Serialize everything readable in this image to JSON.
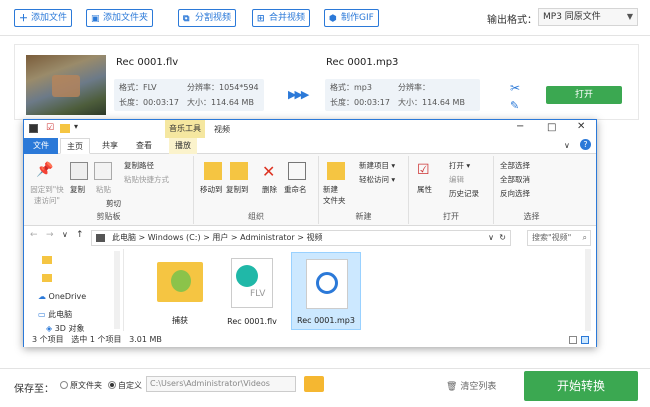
{
  "toolbar": {
    "add_file": "添加文件",
    "add_folder": "添加文件夹",
    "split_video": "分割视频",
    "merge_video": "合并视频",
    "make_gif": "制作GIF",
    "output_format_label": "输出格式：",
    "output_format_value": "MP3  同原文件"
  },
  "task": {
    "source_name": "Rec 0001.flv",
    "source_format_label": "格式：",
    "source_format": "FLV",
    "source_resolution_label": "分辨率：",
    "source_resolution": "1054*594",
    "source_duration_label": "长度：",
    "source_duration": "00:03:17",
    "source_size_label": "大小：",
    "source_size": "114.64 MB",
    "target_name": "Rec 0001.mp3",
    "target_format_label": "格式：",
    "target_format": "mp3",
    "target_resolution_label": "分辨率：",
    "target_resolution": "",
    "target_duration_label": "长度：",
    "target_duration": "00:03:17",
    "target_size_label": "大小：",
    "target_size": "114.64 MB",
    "open_label": "打开"
  },
  "explorer": {
    "title": "视频",
    "context_tab": "音乐工具",
    "tabs": [
      "文件",
      "主页",
      "共享",
      "查看",
      "播放"
    ],
    "clipboard": {
      "pin": "固定到\"快\n速访问\"",
      "copy": "复制",
      "paste": "粘贴",
      "copy_path": "复制路径",
      "paste_shortcut": "粘贴快捷方式",
      "cut": "剪切",
      "group": "剪贴板"
    },
    "organize": {
      "move_to": "移动到",
      "copy_to": "复制到",
      "delete": "删除",
      "rename": "重命名",
      "group": "组织"
    },
    "new": {
      "new_folder": "新建\n文件夹",
      "new_item": "新建项目 ▾",
      "easy_access": "轻松访问 ▾",
      "group": "新建"
    },
    "open": {
      "properties": "属性",
      "open": "打开 ▾",
      "edit": "编辑",
      "history": "历史记录",
      "group": "打开"
    },
    "select": {
      "select_all": "全部选择",
      "select_none": "全部取消",
      "invert": "反向选择",
      "group": "选择"
    },
    "address": [
      "此电脑",
      "Windows (C:)",
      "用户",
      "Administrator",
      "视频"
    ],
    "search_placeholder": "搜索\"视频\"",
    "nav": [
      "OneDrive",
      "此电脑",
      "3D 对象"
    ],
    "files": [
      {
        "name": "捕获",
        "type": "folder"
      },
      {
        "name": "Rec 0001.flv",
        "type": "flv",
        "badge": "FLV"
      },
      {
        "name": "Rec 0001.mp3",
        "type": "mp3"
      }
    ],
    "status": {
      "count": "3 个项目",
      "selected": "选中 1 个项目",
      "size": "3.01 MB"
    }
  },
  "bottom": {
    "save_to_label": "保存至：",
    "option_original": "原文件夹",
    "option_custom": "自定义",
    "path": "C:\\Users\\Administrator\\Videos",
    "clear_list": "清空列表",
    "start": "开始转换"
  },
  "colors": {
    "accent": "#2b79d8",
    "green": "#3ba851",
    "explorer_blue": "#2b79d8"
  }
}
